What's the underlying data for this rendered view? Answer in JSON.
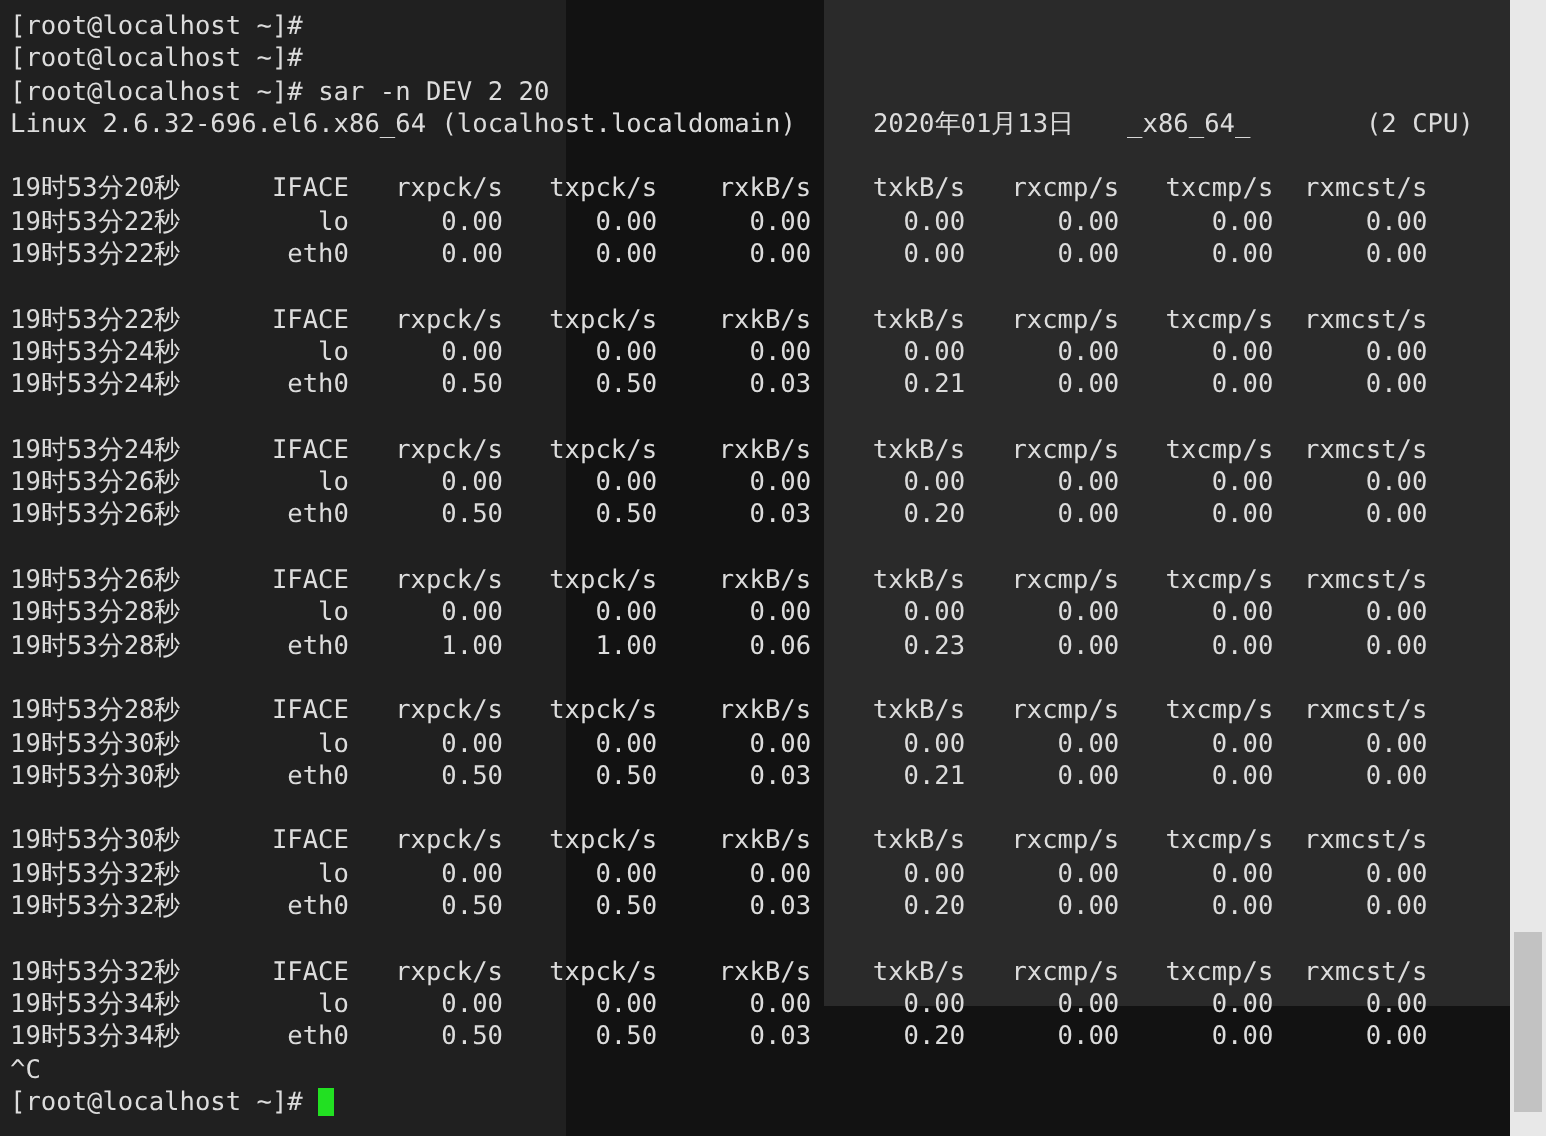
{
  "terminal": {
    "lines": [
      {
        "kind": "text",
        "text": "[root@localhost ~]#"
      },
      {
        "kind": "text",
        "text": "[root@localhost ~]#"
      },
      {
        "kind": "text",
        "text": "[root@localhost ~]# sar -n DEV 2 20"
      },
      {
        "kind": "sysinfo",
        "parts": [
          "Linux 2.6.32-696.el6.x86_64 (localhost.localdomain)",
          "2020年01月13日",
          "_x86_64_",
          "(2 CPU)"
        ]
      },
      {
        "kind": "blank"
      },
      {
        "kind": "header",
        "time": "19时53分20秒",
        "cells": [
          "IFACE",
          "rxpck/s",
          "txpck/s",
          "rxkB/s",
          "txkB/s",
          "rxcmp/s",
          "txcmp/s",
          "rxmcst/s"
        ]
      },
      {
        "kind": "row",
        "time": "19时53分22秒",
        "cells": [
          "lo",
          "0.00",
          "0.00",
          "0.00",
          "0.00",
          "0.00",
          "0.00",
          "0.00"
        ]
      },
      {
        "kind": "row",
        "time": "19时53分22秒",
        "cells": [
          "eth0",
          "0.00",
          "0.00",
          "0.00",
          "0.00",
          "0.00",
          "0.00",
          "0.00"
        ]
      },
      {
        "kind": "blank"
      },
      {
        "kind": "header",
        "time": "19时53分22秒",
        "cells": [
          "IFACE",
          "rxpck/s",
          "txpck/s",
          "rxkB/s",
          "txkB/s",
          "rxcmp/s",
          "txcmp/s",
          "rxmcst/s"
        ]
      },
      {
        "kind": "row",
        "time": "19时53分24秒",
        "cells": [
          "lo",
          "0.00",
          "0.00",
          "0.00",
          "0.00",
          "0.00",
          "0.00",
          "0.00"
        ]
      },
      {
        "kind": "row",
        "time": "19时53分24秒",
        "cells": [
          "eth0",
          "0.50",
          "0.50",
          "0.03",
          "0.21",
          "0.00",
          "0.00",
          "0.00"
        ]
      },
      {
        "kind": "blank"
      },
      {
        "kind": "header",
        "time": "19时53分24秒",
        "cells": [
          "IFACE",
          "rxpck/s",
          "txpck/s",
          "rxkB/s",
          "txkB/s",
          "rxcmp/s",
          "txcmp/s",
          "rxmcst/s"
        ]
      },
      {
        "kind": "row",
        "time": "19时53分26秒",
        "cells": [
          "lo",
          "0.00",
          "0.00",
          "0.00",
          "0.00",
          "0.00",
          "0.00",
          "0.00"
        ]
      },
      {
        "kind": "row",
        "time": "19时53分26秒",
        "cells": [
          "eth0",
          "0.50",
          "0.50",
          "0.03",
          "0.20",
          "0.00",
          "0.00",
          "0.00"
        ]
      },
      {
        "kind": "blank"
      },
      {
        "kind": "header",
        "time": "19时53分26秒",
        "cells": [
          "IFACE",
          "rxpck/s",
          "txpck/s",
          "rxkB/s",
          "txkB/s",
          "rxcmp/s",
          "txcmp/s",
          "rxmcst/s"
        ]
      },
      {
        "kind": "row",
        "time": "19时53分28秒",
        "cells": [
          "lo",
          "0.00",
          "0.00",
          "0.00",
          "0.00",
          "0.00",
          "0.00",
          "0.00"
        ]
      },
      {
        "kind": "row",
        "time": "19时53分28秒",
        "cells": [
          "eth0",
          "1.00",
          "1.00",
          "0.06",
          "0.23",
          "0.00",
          "0.00",
          "0.00"
        ]
      },
      {
        "kind": "blank"
      },
      {
        "kind": "header",
        "time": "19时53分28秒",
        "cells": [
          "IFACE",
          "rxpck/s",
          "txpck/s",
          "rxkB/s",
          "txkB/s",
          "rxcmp/s",
          "txcmp/s",
          "rxmcst/s"
        ]
      },
      {
        "kind": "row",
        "time": "19时53分30秒",
        "cells": [
          "lo",
          "0.00",
          "0.00",
          "0.00",
          "0.00",
          "0.00",
          "0.00",
          "0.00"
        ]
      },
      {
        "kind": "row",
        "time": "19时53分30秒",
        "cells": [
          "eth0",
          "0.50",
          "0.50",
          "0.03",
          "0.21",
          "0.00",
          "0.00",
          "0.00"
        ]
      },
      {
        "kind": "blank"
      },
      {
        "kind": "header",
        "time": "19时53分30秒",
        "cells": [
          "IFACE",
          "rxpck/s",
          "txpck/s",
          "rxkB/s",
          "txkB/s",
          "rxcmp/s",
          "txcmp/s",
          "rxmcst/s"
        ]
      },
      {
        "kind": "row",
        "time": "19时53分32秒",
        "cells": [
          "lo",
          "0.00",
          "0.00",
          "0.00",
          "0.00",
          "0.00",
          "0.00",
          "0.00"
        ]
      },
      {
        "kind": "row",
        "time": "19时53分32秒",
        "cells": [
          "eth0",
          "0.50",
          "0.50",
          "0.03",
          "0.20",
          "0.00",
          "0.00",
          "0.00"
        ]
      },
      {
        "kind": "blank"
      },
      {
        "kind": "header",
        "time": "19时53分32秒",
        "cells": [
          "IFACE",
          "rxpck/s",
          "txpck/s",
          "rxkB/s",
          "txkB/s",
          "rxcmp/s",
          "txcmp/s",
          "rxmcst/s"
        ]
      },
      {
        "kind": "row",
        "time": "19时53分34秒",
        "cells": [
          "lo",
          "0.00",
          "0.00",
          "0.00",
          "0.00",
          "0.00",
          "0.00",
          "0.00"
        ]
      },
      {
        "kind": "row",
        "time": "19时53分34秒",
        "cells": [
          "eth0",
          "0.50",
          "0.50",
          "0.03",
          "0.20",
          "0.00",
          "0.00",
          "0.00"
        ]
      },
      {
        "kind": "text",
        "text": "^C"
      },
      {
        "kind": "prompt",
        "text": "[root@localhost ~]#",
        "cursor": true
      }
    ]
  }
}
